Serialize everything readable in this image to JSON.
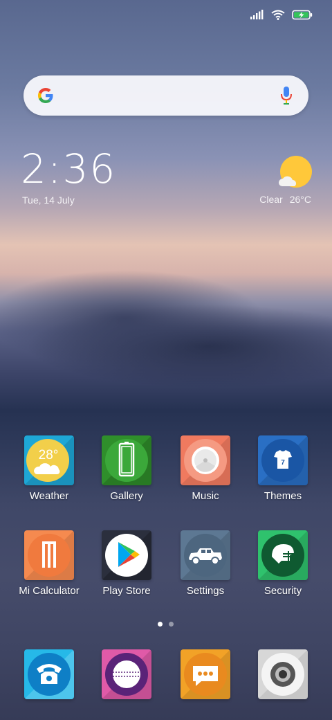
{
  "status_bar": {
    "icons": [
      "signal-icon",
      "wifi-icon",
      "battery-charging-icon"
    ]
  },
  "search": {
    "icons": [
      "google-icon",
      "mic-icon"
    ]
  },
  "clock": {
    "time": "2:36",
    "date": "Tue, 14 July"
  },
  "weather_widget": {
    "condition": "Clear",
    "temperature": "26°C",
    "icon": "sun-cloud-icon"
  },
  "home_apps": [
    {
      "label": "Weather",
      "badge_text": "28°",
      "color": "#1ea7d6"
    },
    {
      "label": "Gallery",
      "color": "#2f8f2b"
    },
    {
      "label": "Music",
      "color": "#f07a5f"
    },
    {
      "label": "Themes",
      "color": "#2a6fc4"
    },
    {
      "label": "Mi Calculator",
      "color": "#f58a4f"
    },
    {
      "label": "Play Store",
      "color": "#2b2f3d"
    },
    {
      "label": "Settings",
      "color": "#5d7893"
    },
    {
      "label": "Security",
      "color": "#2fc26d"
    }
  ],
  "page_indicator": {
    "pages": 2,
    "current": 1
  },
  "dock_apps": [
    {
      "name": "phone",
      "color": "#26b9e8"
    },
    {
      "name": "cricket",
      "color": "#e05aa8"
    },
    {
      "name": "messaging",
      "color": "#f2a227"
    },
    {
      "name": "camera",
      "color": "#d7d7d7"
    }
  ]
}
